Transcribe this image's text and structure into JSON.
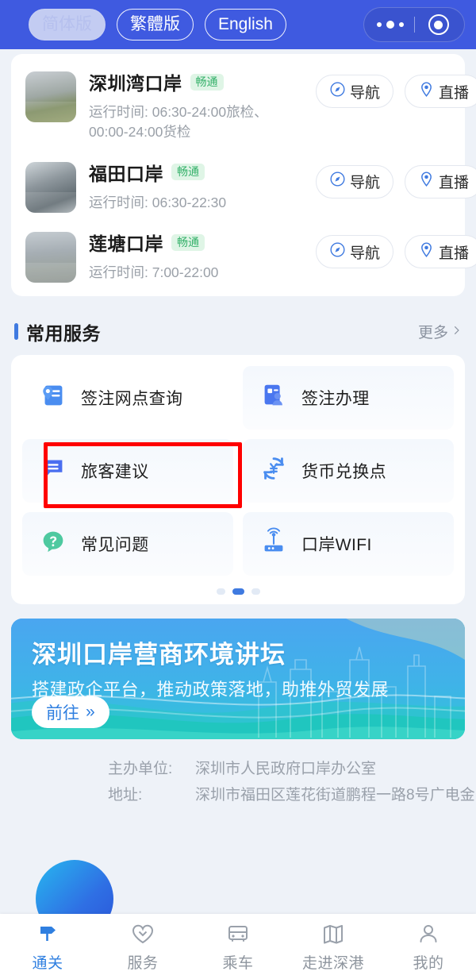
{
  "header": {
    "languages": [
      {
        "label": "简体版",
        "active": true
      },
      {
        "label": "繁體版",
        "active": false
      },
      {
        "label": "English",
        "active": false
      }
    ],
    "capsule": {
      "menu_icon": "more-dots-icon",
      "target_icon": "target-circle-icon"
    }
  },
  "ports": [
    {
      "name": "深圳湾口岸",
      "status": "畅通",
      "hours": "运行时间: 06:30-24:00旅检、00:00-24:00货检",
      "nav_label": "导航",
      "live_label": "直播",
      "thumb": "shenzhenwan-port-photo"
    },
    {
      "name": "福田口岸",
      "status": "畅通",
      "hours": "运行时间: 06:30-22:30",
      "nav_label": "导航",
      "live_label": "直播",
      "thumb": "futian-port-photo"
    },
    {
      "name": "莲塘口岸",
      "status": "畅通",
      "hours": "运行时间: 7:00-22:00",
      "nav_label": "导航",
      "live_label": "直播",
      "thumb": "liantang-port-photo"
    }
  ],
  "services": {
    "title": "常用服务",
    "more": "更多",
    "items": [
      {
        "label": "签注网点查询",
        "icon": "card-pin-icon",
        "highlighted": true
      },
      {
        "label": "签注办理",
        "icon": "id-person-icon",
        "highlighted": false
      },
      {
        "label": "旅客建议",
        "icon": "chat-bubble-icon",
        "highlighted": false
      },
      {
        "label": "货币兑换点",
        "icon": "currency-exchange-icon",
        "highlighted": false
      },
      {
        "label": "常见问题",
        "icon": "question-bubble-icon",
        "highlighted": false
      },
      {
        "label": "口岸WIFI",
        "icon": "wifi-router-icon",
        "highlighted": false
      }
    ],
    "pager": {
      "total": 3,
      "active_index": 1
    }
  },
  "banner": {
    "title": "深圳口岸营商环境讲坛",
    "subtitle": "搭建政企平台，推动政策落地，助推外贸发展",
    "button": "前往",
    "button_arrow": "»"
  },
  "footer": {
    "lines": [
      {
        "key": "主办单位:",
        "value": "深圳市人民政府口岸办公室"
      },
      {
        "key": "地址:",
        "value": "深圳市福田区莲花街道鹏程一路8号广电金"
      }
    ]
  },
  "tabbar": [
    {
      "label": "通关",
      "icon": "signpost-icon",
      "active": true
    },
    {
      "label": "服务",
      "icon": "heart-service-icon",
      "active": false
    },
    {
      "label": "乘车",
      "icon": "bus-icon",
      "active": false
    },
    {
      "label": "走进深港",
      "icon": "map-icon",
      "active": false
    },
    {
      "label": "我的",
      "icon": "person-icon",
      "active": false
    }
  ],
  "colors": {
    "header_bg": "#3f5ae0",
    "accent": "#2f7fe0",
    "status_green": "#35b16a",
    "highlight_red": "#ff0000"
  }
}
